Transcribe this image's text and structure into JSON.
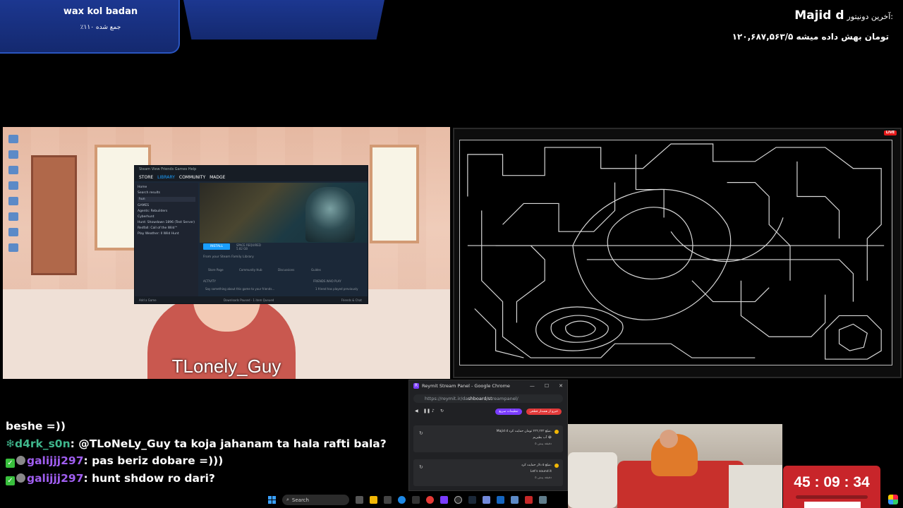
{
  "donor_panel": {
    "label": "آخرین دونیتور:",
    "name": "Majid d",
    "amount_text": "۱۲۰,۶۸۷,۵۶۳/۵ تومان بهش داده میشه"
  },
  "goal_panel": {
    "title": "wax kol badan",
    "progress_text": "٪۱۱۰ جمع شده"
  },
  "game": {
    "caption": "TLonely_Guy",
    "steam": {
      "window_menu": "Steam  View  Friends  Games  Help",
      "nav": [
        "STORE",
        "LIBRARY",
        "COMMUNITY",
        "MADGE"
      ],
      "active_nav": "LIBRARY",
      "left_items": [
        "Home",
        "Search results",
        "GAMES",
        "Agents: Rebuilders",
        "Cyberhunt",
        "Hunt: Showdown 1896 (Test Server)",
        "Redfall: Call of the Wild™",
        "Play Weather: Il Wild Hunt"
      ],
      "search_value": "hun",
      "install_label": "INSTALL",
      "space_required": "SPACE REQUIRED",
      "space_value": "5.82 GB",
      "family_note": "From your Steam Family Library",
      "tabs": [
        "Store Page",
        "Community Hub",
        "Discussions",
        "Guides"
      ],
      "activity": "ACTIVITY",
      "activity_hint": "Say something about this game to your friends...",
      "friends_label": "FRIENDS WHO PLAY",
      "friends_note": "1 friend has played previously",
      "footer_left": "Add a Game",
      "footer_center": "Downloads Paused - 1 item Queued",
      "footer_right": "Friends & Chat"
    }
  },
  "drawing": {
    "live_label": "LIVE"
  },
  "chat": {
    "messages": [
      {
        "user": "",
        "text": "beshe =))",
        "color": "",
        "badges": []
      },
      {
        "user": "d4rk_s0n",
        "text": ": @TLoNeLy_Guy ta koja jahanam ta hala rafti bala?",
        "color": "#3fb68c",
        "badges": [
          "snowflake"
        ]
      },
      {
        "user": "galijjj297",
        "text": ": pas beriz dobare =)))",
        "color": "#a05ef0",
        "badges": [
          "check",
          "bot"
        ]
      },
      {
        "user": "galijjj297",
        "text": ": hunt shdow ro dari?",
        "color": "#a05ef0",
        "badges": [
          "check",
          "bot"
        ]
      }
    ]
  },
  "chrome": {
    "title": "Reymit Stream Panel - Google Chrome",
    "url_prefix": "https://reymit.ir/da",
    "url_mid": "shboard/st",
    "url_suffix": "reampanel/",
    "btn_red": "خبرو از هشدار قطعی",
    "btn_purple": "تنظیمات سریع",
    "cards": [
      {
        "line1": "Majid d مبلغ ۳۳۳,۳۳۳ تومان حمایت کرد.",
        "line2": "آب بطیریم 😂",
        "line3": "۵ دقیقه پیش"
      },
      {
        "line1": "مبلغ ۵ دلار حمایت کرد.",
        "line2": "Let's sound it",
        "line3": "۵ دقیقه پیش"
      }
    ]
  },
  "timer": {
    "text": "45 : 09 : 34"
  },
  "taskbar": {
    "search_label": "Search"
  }
}
